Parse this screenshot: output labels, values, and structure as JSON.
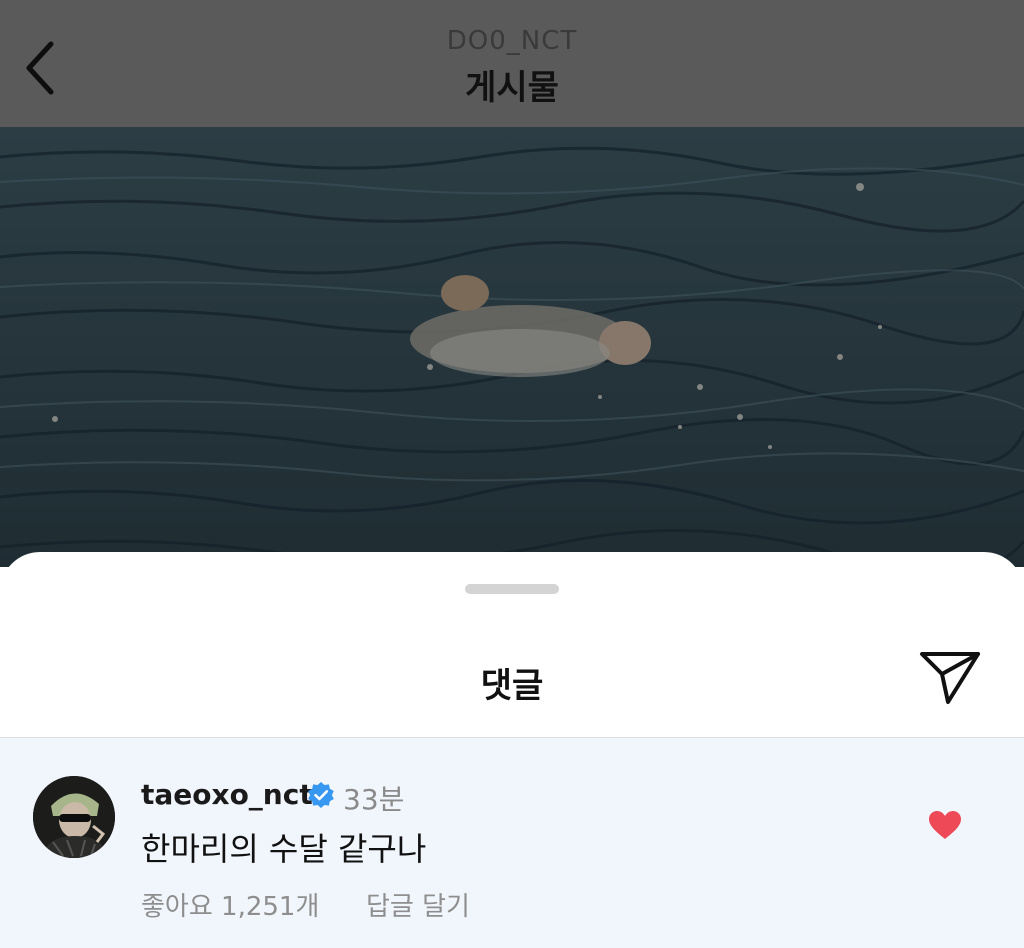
{
  "header": {
    "username": "DO0_NCT",
    "title": "게시물"
  },
  "sheet": {
    "title": "댓글"
  },
  "comment": {
    "username": "taeoxo_nct",
    "time": "33분",
    "text": "한마리의 수달 같구나",
    "likes": "좋아요 1,251개",
    "reply_label": "답글 달기",
    "liked": true
  },
  "icons": {
    "back": "chevron-left-icon",
    "share": "paper-plane-icon",
    "verified": "verified-badge-icon",
    "like": "heart-icon"
  },
  "colors": {
    "header_bg": "#5a5a5a",
    "comment_bg": "#f1f6fc",
    "verified_blue": "#3897f0",
    "heart_red": "#ed4956"
  }
}
